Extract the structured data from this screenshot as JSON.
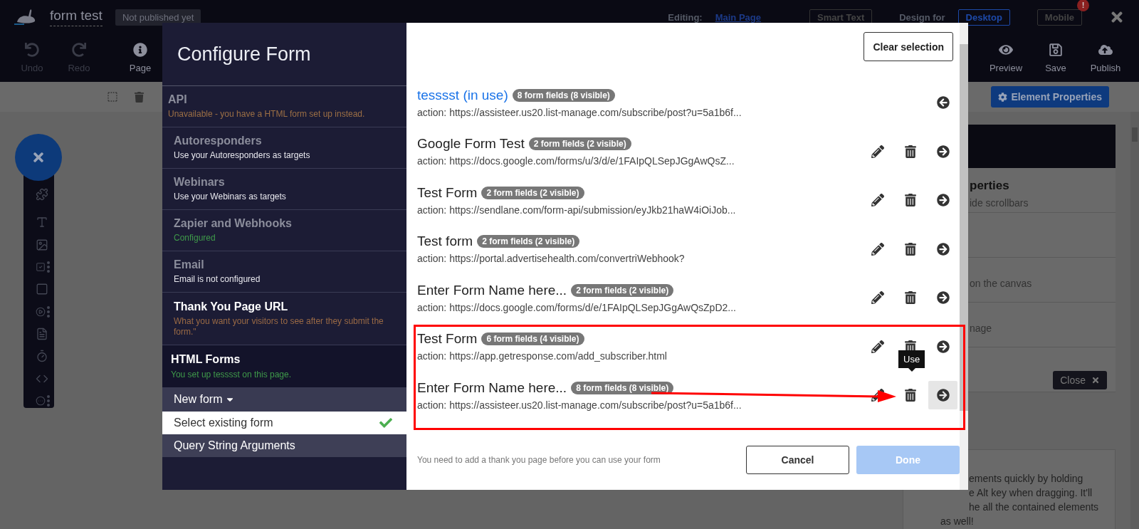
{
  "app_bar": {
    "title": "form test",
    "status": "Not published yet",
    "editing_label": "Editing:",
    "editing_page": "Main Page",
    "smart_text": "Smart Text",
    "design_for_label": "Design for",
    "devices": [
      {
        "label": "Desktop",
        "selected": true
      },
      {
        "label": "Mobile",
        "selected": false,
        "alert": "!"
      }
    ]
  },
  "toolbar": {
    "left": [
      {
        "label": "Undo",
        "kind": "undo",
        "disabled": true
      },
      {
        "label": "Redo",
        "kind": "redo",
        "disabled": true
      },
      {
        "label": "Page",
        "kind": "info",
        "disabled": false
      }
    ],
    "right": [
      {
        "label": "Preview",
        "kind": "eye",
        "disabled": false
      },
      {
        "label": "Save",
        "kind": "save",
        "disabled": false
      },
      {
        "label": "Publish",
        "kind": "publish",
        "disabled": false
      }
    ]
  },
  "edit_bar": {
    "element_properties": "Element Properties"
  },
  "element_tools": [
    {
      "kind": "puzzle",
      "more": false
    },
    {
      "kind": "text",
      "more": false
    },
    {
      "kind": "image",
      "more": false
    },
    {
      "kind": "checkbox",
      "more": true
    },
    {
      "kind": "box",
      "more": false
    },
    {
      "kind": "video",
      "more": true
    },
    {
      "kind": "list",
      "more": false
    },
    {
      "kind": "timer",
      "more": false
    },
    {
      "kind": "code",
      "more": false
    },
    {
      "kind": "ellipsis",
      "more": true
    }
  ],
  "properties_panel": {
    "sections": [
      {
        "kind": "text",
        "title": "perties",
        "text": "ide scrollbars"
      },
      {
        "kind": "empty"
      },
      {
        "kind": "text",
        "text": "on the canvas"
      },
      {
        "kind": "text",
        "text": "nage"
      },
      {
        "kind": "empty"
      }
    ],
    "close_button": "Close",
    "tip_lines": [
      "ements quickly by holding",
      "e Alt key when dragging. It'll",
      "he all the contained elements",
      "as well!"
    ]
  },
  "dialog": {
    "title": "Configure Form",
    "integrations": [
      {
        "title": "API",
        "subtitle": "Unavailable - you have a HTML form set up instead.",
        "color": "#9c6f45",
        "highlighted": false
      },
      {
        "title": "Autoresponders",
        "subtitle": "Use your Autoresponders as targets",
        "color": "#e8e8ee",
        "highlighted": false
      },
      {
        "title": "Webinars",
        "subtitle": "Use your Webinars as targets",
        "color": "#e8e8ee",
        "highlighted": false
      },
      {
        "title": "Zapier and Webhooks",
        "subtitle": "Configured",
        "color": "#3f9a4a",
        "highlighted": false
      },
      {
        "title": "Email",
        "subtitle": "Email is not configured",
        "color": "#e8e8ee",
        "highlighted": false
      },
      {
        "title": "Thank You Page URL",
        "subtitle": "What you want your visitors to see after they submit the form.\"",
        "color": "#9a6a45",
        "highlighted": true
      }
    ],
    "html_forms": {
      "title": "HTML Forms",
      "subtitle": "You set up tesssst on this page.",
      "menu": [
        {
          "label": "New form",
          "kind": "dropdown",
          "selected": false
        },
        {
          "label": "Select existing form",
          "kind": "option",
          "selected": true
        },
        {
          "label": "Query String Arguments",
          "kind": "option",
          "selected": false
        }
      ]
    },
    "clear_selection": "Clear selection",
    "forms": [
      {
        "name": "tesssst (in use)",
        "badge": "8 form fields (8 visible)",
        "action": "action: https://assisteer.us20.list-manage.com/subscribe/post?u=5a1b6f...",
        "in_use": true,
        "hovered": false
      },
      {
        "name": "Google Form Test",
        "badge": "2 form fields (2 visible)",
        "action": "action: https://docs.google.com/forms/u/3/d/e/1FAIpQLSepJGgAwQsZ...",
        "in_use": false,
        "hovered": false
      },
      {
        "name": "Test Form",
        "badge": "2 form fields (2 visible)",
        "action": "action: https://sendlane.com/form-api/submission/eyJkb21haW4iOiJob...",
        "in_use": false,
        "hovered": false
      },
      {
        "name": "Test form",
        "badge": "2 form fields (2 visible)",
        "action": "action: https://portal.advertisehealth.com/convertriWebhook?",
        "in_use": false,
        "hovered": false
      },
      {
        "name": "Enter Form Name here...",
        "badge": "2 form fields (2 visible)",
        "action": "action: https://docs.google.com/forms/d/e/1FAIpQLSepJGgAwQsZpD2...",
        "in_use": false,
        "hovered": false
      },
      {
        "name": "Test Form",
        "badge": "6 form fields (4 visible)",
        "action": "action: https://app.getresponse.com/add_subscriber.html",
        "in_use": false,
        "hovered": false
      },
      {
        "name": "Enter Form Name here...",
        "badge": "8 form fields (8 visible)",
        "action": "action: https://assisteer.us20.list-manage.com/subscribe/post?u=5a1b6f...",
        "in_use": false,
        "hovered": true
      }
    ],
    "tooltip": "Use",
    "footer_note": "You need to add a thank you page before you can use your form",
    "cancel": "Cancel",
    "done": "Done",
    "done_disabled": true
  }
}
